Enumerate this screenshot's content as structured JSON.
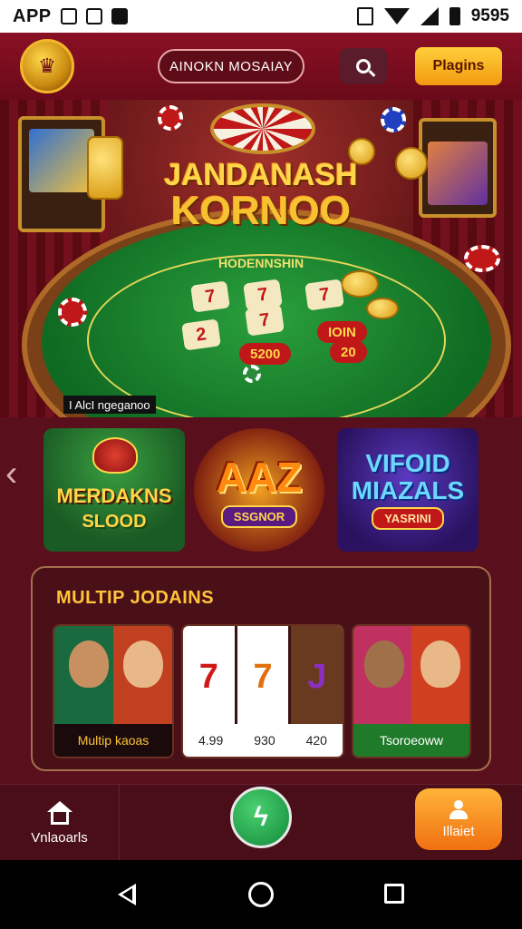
{
  "status_bar": {
    "app_label": "APP",
    "time": "9595",
    "icons": [
      "notification-icon",
      "image-icon",
      "mail-icon",
      "vibrate-icon",
      "wifi-icon",
      "signal-icon",
      "battery-icon"
    ]
  },
  "header": {
    "logo_icon": "jester-logo",
    "title": "AINOKN MOSAIAY",
    "search_icon": "search-icon",
    "action_label": "Plagins"
  },
  "hero": {
    "title_line1": "JANDANASH",
    "title_line2": "KORNOO",
    "felt_text": "HODENNSHIN",
    "cards": [
      "7",
      "7",
      "7",
      "2",
      "7"
    ],
    "bets": [
      "5200",
      "IOIN",
      "20"
    ],
    "caption": "I AlcI ngeganoo"
  },
  "featured": {
    "prev_icon": "chevron-left-icon",
    "games": [
      {
        "title": "MERDAKNS",
        "subtitle": "SLOOD"
      },
      {
        "title": "AAZ",
        "subtitle": "SSGNOR"
      },
      {
        "title": "VIFOID MIAZALS",
        "subtitle": "YASRINI"
      }
    ]
  },
  "panel": {
    "title": "MULTIP JODAINS",
    "tiles": [
      {
        "label": "Multip kaoas"
      },
      {
        "reels": [
          "7",
          "7",
          "J"
        ],
        "labels": [
          "4.99",
          "930",
          "420"
        ]
      },
      {
        "label": "Tsoroeoww"
      }
    ]
  },
  "bottom_nav": {
    "home_label": "Vnlaoarls",
    "center_icon": "bolt-icon",
    "right_label": "Illaiet"
  },
  "colors": {
    "brand": "#8a1024",
    "accent": "#ffc43a",
    "felt": "#1f8a34"
  }
}
